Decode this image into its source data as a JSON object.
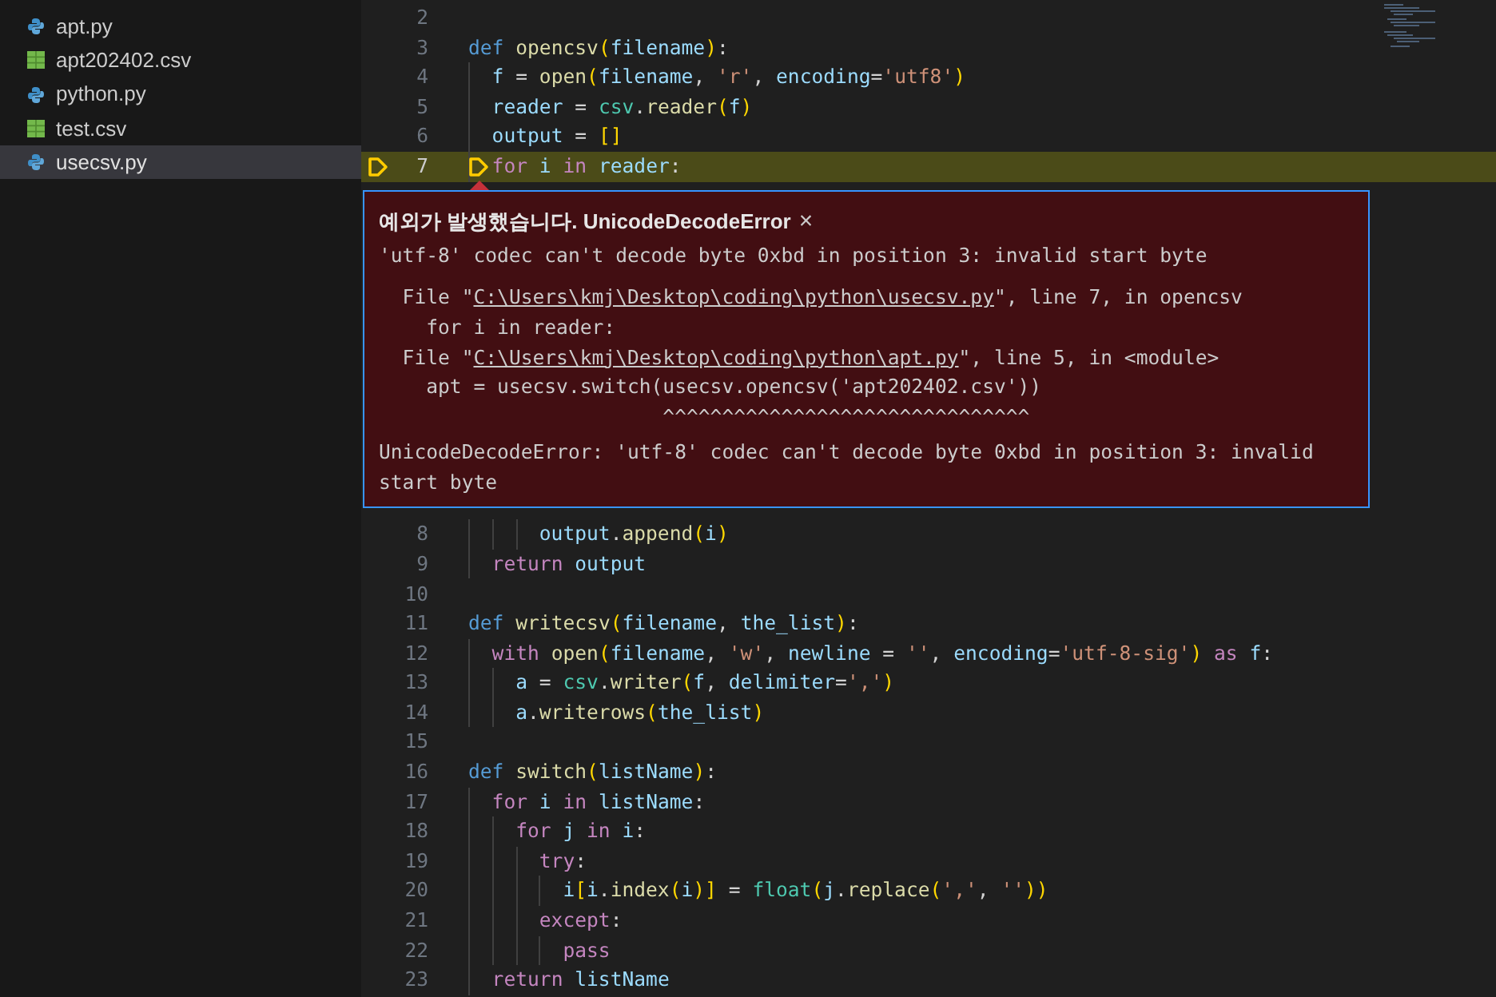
{
  "sidebar": {
    "files": [
      {
        "name": "apt.py",
        "kind": "python",
        "selected": false
      },
      {
        "name": "apt202402.csv",
        "kind": "csv",
        "selected": false
      },
      {
        "name": "python.py",
        "kind": "python",
        "selected": false
      },
      {
        "name": "test.csv",
        "kind": "csv",
        "selected": false
      },
      {
        "name": "usecsv.py",
        "kind": "python",
        "selected": true
      }
    ]
  },
  "editor": {
    "lines_before": [
      {
        "number": "2",
        "current": false
      },
      {
        "number": "3",
        "current": false,
        "tokens": [
          {
            "text": "def ",
            "kind": "keyword"
          },
          {
            "text": "opencsv",
            "kind": "function"
          },
          {
            "text": "(",
            "kind": "bracket"
          },
          {
            "text": "filename",
            "kind": "variable"
          },
          {
            "text": ")",
            "kind": "bracket"
          },
          {
            "text": ":",
            "kind": "plain"
          }
        ]
      },
      {
        "number": "4",
        "current": false,
        "tokens": [
          {
            "text": "  f",
            "kind": "variable"
          },
          {
            "text": " = ",
            "kind": "plain"
          },
          {
            "text": "open",
            "kind": "function"
          },
          {
            "text": "(",
            "kind": "bracket"
          },
          {
            "text": "filename",
            "kind": "variable"
          },
          {
            "text": ", ",
            "kind": "plain"
          },
          {
            "text": "'r'",
            "kind": "string"
          },
          {
            "text": ", ",
            "kind": "plain"
          },
          {
            "text": "encoding",
            "kind": "variable"
          },
          {
            "text": "=",
            "kind": "plain"
          },
          {
            "text": "'utf8'",
            "kind": "string"
          },
          {
            "text": ")",
            "kind": "bracket"
          }
        ]
      },
      {
        "number": "5",
        "current": false,
        "tokens": [
          {
            "text": "  reader",
            "kind": "variable"
          },
          {
            "text": " = ",
            "kind": "plain"
          },
          {
            "text": "csv",
            "kind": "module"
          },
          {
            "text": ".",
            "kind": "plain"
          },
          {
            "text": "reader",
            "kind": "function"
          },
          {
            "text": "(",
            "kind": "bracket"
          },
          {
            "text": "f",
            "kind": "variable"
          },
          {
            "text": ")",
            "kind": "bracket"
          }
        ]
      },
      {
        "number": "6",
        "current": false,
        "tokens": [
          {
            "text": "  output",
            "kind": "variable"
          },
          {
            "text": " = ",
            "kind": "plain"
          },
          {
            "text": "[]",
            "kind": "bracket"
          }
        ]
      },
      {
        "number": "7",
        "current": true,
        "tokens": [
          {
            "text": "  for",
            "kind": "control"
          },
          {
            "text": " i ",
            "kind": "variable"
          },
          {
            "text": "in",
            "kind": "control"
          },
          {
            "text": " reader",
            "kind": "variable"
          },
          {
            "text": ":",
            "kind": "plain"
          }
        ]
      }
    ],
    "exception": {
      "heading": "예외가 발생했습니다. UnicodeDecodeError",
      "close": "×",
      "message": "'utf-8' codec can't decode byte 0xbd in position 3: invalid start byte",
      "traceback": [
        {
          "parts": [
            {
              "text": "  File \"",
              "link": false
            },
            {
              "text": "C:\\Users\\kmj\\Desktop\\coding\\python\\usecsv.py",
              "link": true
            },
            {
              "text": "\", line 7, in opencsv",
              "link": false
            }
          ]
        },
        {
          "parts": [
            {
              "text": "    for i in reader:",
              "link": false
            }
          ]
        },
        {
          "parts": [
            {
              "text": "  File \"",
              "link": false
            },
            {
              "text": "C:\\Users\\kmj\\Desktop\\coding\\python\\apt.py",
              "link": true
            },
            {
              "text": "\", line 5, in <module>",
              "link": false
            }
          ]
        },
        {
          "parts": [
            {
              "text": "    apt = usecsv.switch(usecsv.opencsv('apt202402.csv'))",
              "link": false
            }
          ]
        },
        {
          "parts": [
            {
              "text": "                        ^^^^^^^^^^^^^^^^^^^^^^^^^^^^^^^",
              "link": false
            }
          ]
        }
      ],
      "summary": "UnicodeDecodeError: 'utf-8' codec can't decode byte 0xbd in position 3: invalid start byte"
    },
    "lines_after": [
      {
        "number": "8",
        "current": false,
        "tokens": [
          {
            "text": "      output",
            "kind": "variable"
          },
          {
            "text": ".",
            "kind": "plain"
          },
          {
            "text": "append",
            "kind": "function"
          },
          {
            "text": "(",
            "kind": "bracket"
          },
          {
            "text": "i",
            "kind": "variable"
          },
          {
            "text": ")",
            "kind": "bracket"
          }
        ]
      },
      {
        "number": "9",
        "current": false,
        "tokens": [
          {
            "text": "  return",
            "kind": "control"
          },
          {
            "text": " output",
            "kind": "variable"
          }
        ]
      },
      {
        "number": "10",
        "current": false
      },
      {
        "number": "11",
        "current": false,
        "tokens": [
          {
            "text": "def ",
            "kind": "keyword"
          },
          {
            "text": "writecsv",
            "kind": "function"
          },
          {
            "text": "(",
            "kind": "bracket"
          },
          {
            "text": "filename",
            "kind": "variable"
          },
          {
            "text": ", ",
            "kind": "plain"
          },
          {
            "text": "the_list",
            "kind": "variable"
          },
          {
            "text": ")",
            "kind": "bracket"
          },
          {
            "text": ":",
            "kind": "plain"
          }
        ]
      },
      {
        "number": "12",
        "current": false,
        "tokens": [
          {
            "text": "  with ",
            "kind": "control"
          },
          {
            "text": "open",
            "kind": "function"
          },
          {
            "text": "(",
            "kind": "bracket"
          },
          {
            "text": "filename",
            "kind": "variable"
          },
          {
            "text": ", ",
            "kind": "plain"
          },
          {
            "text": "'w'",
            "kind": "string"
          },
          {
            "text": ", ",
            "kind": "plain"
          },
          {
            "text": "newline",
            "kind": "variable"
          },
          {
            "text": " = ",
            "kind": "plain"
          },
          {
            "text": "''",
            "kind": "string"
          },
          {
            "text": ", ",
            "kind": "plain"
          },
          {
            "text": "encoding",
            "kind": "variable"
          },
          {
            "text": "=",
            "kind": "plain"
          },
          {
            "text": "'utf-8-sig'",
            "kind": "string"
          },
          {
            "text": ")",
            "kind": "bracket"
          },
          {
            "text": " as",
            "kind": "control"
          },
          {
            "text": " f",
            "kind": "variable"
          },
          {
            "text": ":",
            "kind": "plain"
          }
        ]
      },
      {
        "number": "13",
        "current": false,
        "tokens": [
          {
            "text": "    a",
            "kind": "variable"
          },
          {
            "text": " = ",
            "kind": "plain"
          },
          {
            "text": "csv",
            "kind": "module"
          },
          {
            "text": ".",
            "kind": "plain"
          },
          {
            "text": "writer",
            "kind": "function"
          },
          {
            "text": "(",
            "kind": "bracket"
          },
          {
            "text": "f",
            "kind": "variable"
          },
          {
            "text": ", ",
            "kind": "plain"
          },
          {
            "text": "delimiter",
            "kind": "variable"
          },
          {
            "text": "=",
            "kind": "plain"
          },
          {
            "text": "','",
            "kind": "string"
          },
          {
            "text": ")",
            "kind": "bracket"
          }
        ]
      },
      {
        "number": "14",
        "current": false,
        "tokens": [
          {
            "text": "    a",
            "kind": "variable"
          },
          {
            "text": ".",
            "kind": "plain"
          },
          {
            "text": "writerows",
            "kind": "function"
          },
          {
            "text": "(",
            "kind": "bracket"
          },
          {
            "text": "the_list",
            "kind": "variable"
          },
          {
            "text": ")",
            "kind": "bracket"
          }
        ]
      },
      {
        "number": "15",
        "current": false
      },
      {
        "number": "16",
        "current": false,
        "tokens": [
          {
            "text": "def ",
            "kind": "keyword"
          },
          {
            "text": "switch",
            "kind": "function"
          },
          {
            "text": "(",
            "kind": "bracket"
          },
          {
            "text": "listName",
            "kind": "variable"
          },
          {
            "text": ")",
            "kind": "bracket"
          },
          {
            "text": ":",
            "kind": "plain"
          }
        ]
      },
      {
        "number": "17",
        "current": false,
        "tokens": [
          {
            "text": "  for",
            "kind": "control"
          },
          {
            "text": " i ",
            "kind": "variable"
          },
          {
            "text": "in",
            "kind": "control"
          },
          {
            "text": " listName",
            "kind": "variable"
          },
          {
            "text": ":",
            "kind": "plain"
          }
        ]
      },
      {
        "number": "18",
        "current": false,
        "tokens": [
          {
            "text": "    for",
            "kind": "control"
          },
          {
            "text": " j ",
            "kind": "variable"
          },
          {
            "text": "in",
            "kind": "control"
          },
          {
            "text": " i",
            "kind": "variable"
          },
          {
            "text": ":",
            "kind": "plain"
          }
        ]
      },
      {
        "number": "19",
        "current": false,
        "tokens": [
          {
            "text": "      try",
            "kind": "control"
          },
          {
            "text": ":",
            "kind": "plain"
          }
        ]
      },
      {
        "number": "20",
        "current": false,
        "tokens": [
          {
            "text": "        i",
            "kind": "variable"
          },
          {
            "text": "[",
            "kind": "bracket"
          },
          {
            "text": "i",
            "kind": "variable"
          },
          {
            "text": ".",
            "kind": "plain"
          },
          {
            "text": "index",
            "kind": "function"
          },
          {
            "text": "(",
            "kind": "bracket"
          },
          {
            "text": "i",
            "kind": "variable"
          },
          {
            "text": ")]",
            "kind": "bracket"
          },
          {
            "text": " = ",
            "kind": "plain"
          },
          {
            "text": "float",
            "kind": "module"
          },
          {
            "text": "(",
            "kind": "bracket"
          },
          {
            "text": "j",
            "kind": "variable"
          },
          {
            "text": ".",
            "kind": "plain"
          },
          {
            "text": "replace",
            "kind": "function"
          },
          {
            "text": "(",
            "kind": "bracket"
          },
          {
            "text": "','",
            "kind": "string"
          },
          {
            "text": ", ",
            "kind": "plain"
          },
          {
            "text": "''",
            "kind": "string"
          },
          {
            "text": "))",
            "kind": "bracket"
          }
        ]
      },
      {
        "number": "21",
        "current": false,
        "tokens": [
          {
            "text": "      except",
            "kind": "control"
          },
          {
            "text": ":",
            "kind": "plain"
          }
        ]
      },
      {
        "number": "22",
        "current": false,
        "tokens": [
          {
            "text": "        pass",
            "kind": "control"
          }
        ]
      },
      {
        "number": "23",
        "current": false,
        "tokens": [
          {
            "text": "  return",
            "kind": "control"
          },
          {
            "text": " listName",
            "kind": "variable"
          }
        ]
      }
    ]
  }
}
